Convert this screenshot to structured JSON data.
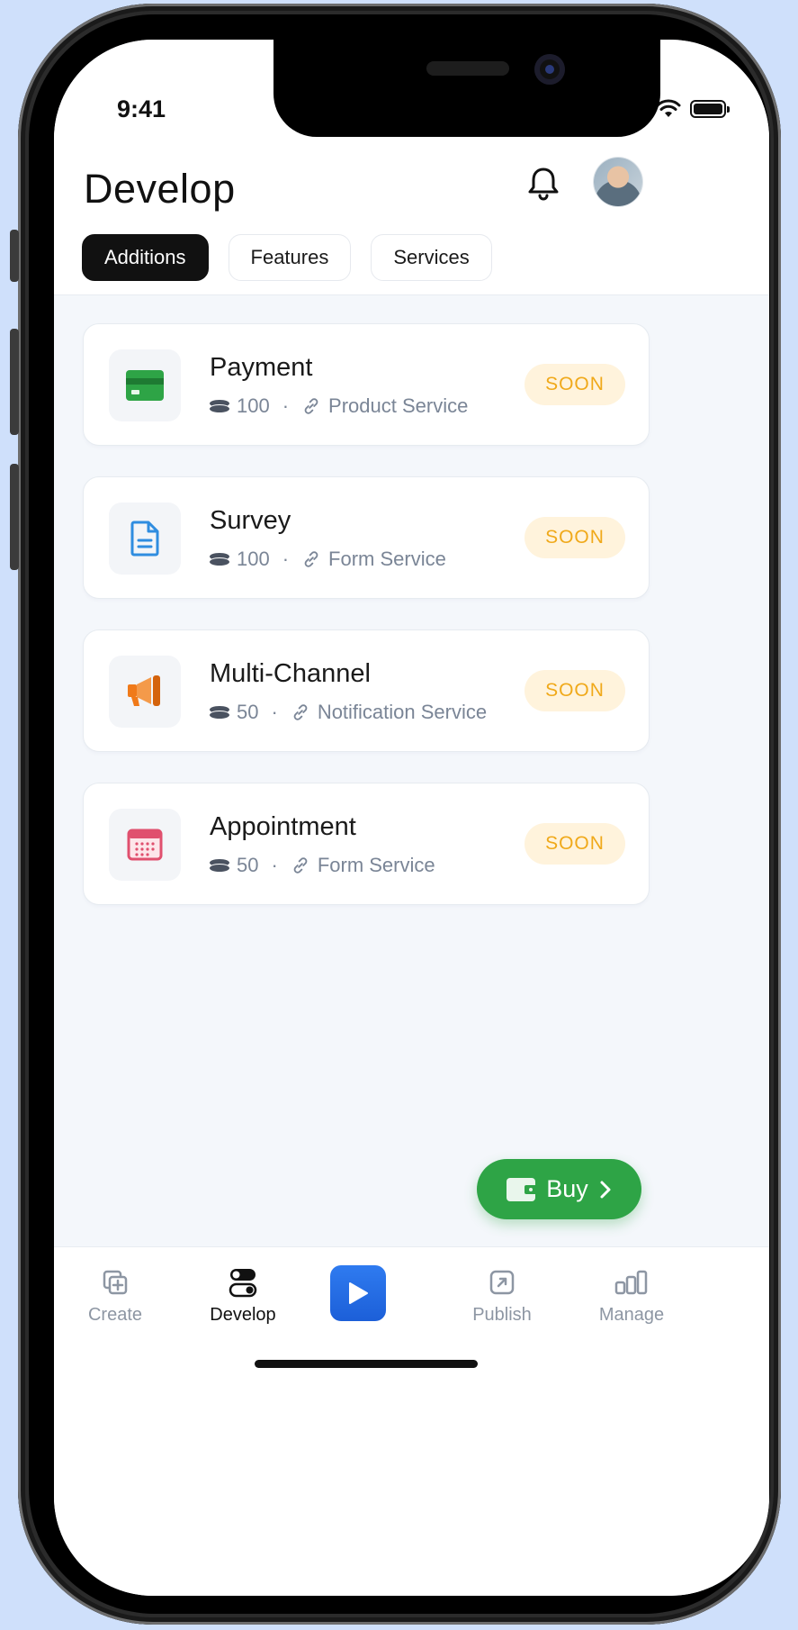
{
  "status_bar": {
    "time": "9:41"
  },
  "header": {
    "title": "Develop"
  },
  "tabs": [
    {
      "label": "Additions",
      "active": true
    },
    {
      "label": "Features",
      "active": false
    },
    {
      "label": "Services",
      "active": false
    }
  ],
  "cards": [
    {
      "title": "Payment",
      "amount": "100",
      "service": "Product Service",
      "badge": "SOON",
      "icon": "credit-card-icon",
      "icon_color": "#2ea446"
    },
    {
      "title": "Survey",
      "amount": "100",
      "service": "Form Service",
      "badge": "SOON",
      "icon": "document-icon",
      "icon_color": "#2f8de0"
    },
    {
      "title": "Multi-Channel",
      "amount": "50",
      "service": "Notification Service",
      "badge": "SOON",
      "icon": "megaphone-icon",
      "icon_color": "#f07a1a"
    },
    {
      "title": "Appointment",
      "amount": "50",
      "service": "Form Service",
      "badge": "SOON",
      "icon": "calendar-icon",
      "icon_color": "#e0506e"
    }
  ],
  "buy_button": {
    "label": "Buy"
  },
  "bottom_nav": [
    {
      "label": "Create",
      "icon": "create-icon",
      "active": false
    },
    {
      "label": "Develop",
      "icon": "toggle-icon",
      "active": true
    },
    {
      "label": "",
      "icon": "play-icon",
      "active": false
    },
    {
      "label": "Publish",
      "icon": "publish-icon",
      "active": false
    },
    {
      "label": "Manage",
      "icon": "bar-chart-icon",
      "active": false
    }
  ],
  "colors": {
    "accent_green": "#2ea446",
    "badge_bg": "#fff3dc",
    "badge_text": "#f0a91a",
    "play_blue": "#1c5fd8"
  }
}
